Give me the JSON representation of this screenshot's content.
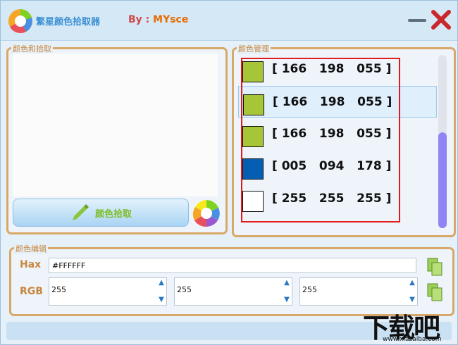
{
  "app": {
    "title": "繁星颜色拾取器",
    "byline_prefix": "By : ",
    "byline_name": "MYsce"
  },
  "picker": {
    "group_title": "颜色和拾取",
    "pick_button_label": "颜色拾取"
  },
  "manager": {
    "group_title": "颜色管理",
    "colors": [
      {
        "r": "166",
        "g": "198",
        "b": "055",
        "hex": "#a6c637"
      },
      {
        "r": "166",
        "g": "198",
        "b": "055",
        "hex": "#a6c637",
        "selected": true
      },
      {
        "r": "166",
        "g": "198",
        "b": "055",
        "hex": "#a6c637"
      },
      {
        "r": "005",
        "g": "094",
        "b": "178",
        "hex": "#055eb2"
      },
      {
        "r": "255",
        "g": "255",
        "b": "255",
        "hex": "#ffffff"
      }
    ]
  },
  "editor": {
    "group_title": "颜色编辑",
    "hex_label": "Hax",
    "hex_value": "#FFFFFF",
    "rgb_label": "RGB",
    "r_value": "255",
    "g_value": "255",
    "b_value": "255"
  },
  "watermark": {
    "main": "下载吧",
    "sub": "www.xiazaiba.com"
  },
  "colors": {
    "accent": "#3a8fd4",
    "group_border": "#d7a869",
    "highlight": "#e31b1b",
    "scroll_thumb": "#8e84f3"
  }
}
